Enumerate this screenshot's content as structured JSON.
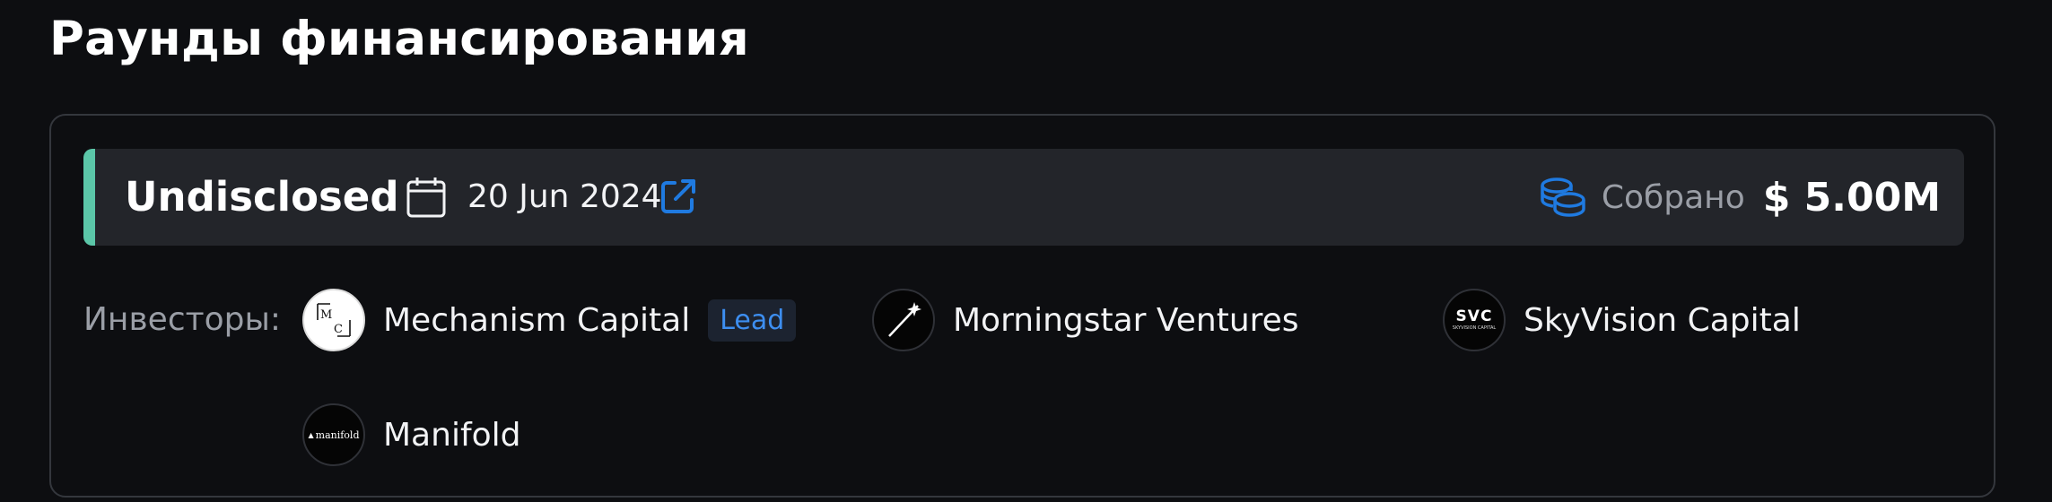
{
  "section": {
    "title": "Раунды финансирования"
  },
  "round": {
    "type": "Undisclosed",
    "date": "20 Jun 2024",
    "raised_label": "Собрано",
    "raised_amount": "$ 5.00M",
    "accent_color": "#5bc6a8",
    "link_color": "#1f7ae0"
  },
  "investors": {
    "label": "Инвесторы:",
    "items": [
      {
        "name": "Mechanism Capital",
        "badge": "Lead",
        "logo_text": "MC",
        "icon": "mechanism-capital-logo"
      },
      {
        "name": "Morningstar Ventures",
        "icon": "morningstar-ventures-logo"
      },
      {
        "name": "SkyVision Capital",
        "logo_text": "SVC",
        "logo_subtext": "SKYVISION CAPITAL",
        "icon": "skyvision-capital-logo"
      },
      {
        "name": "Manifold",
        "logo_text": "manifold",
        "icon": "manifold-logo"
      }
    ]
  }
}
